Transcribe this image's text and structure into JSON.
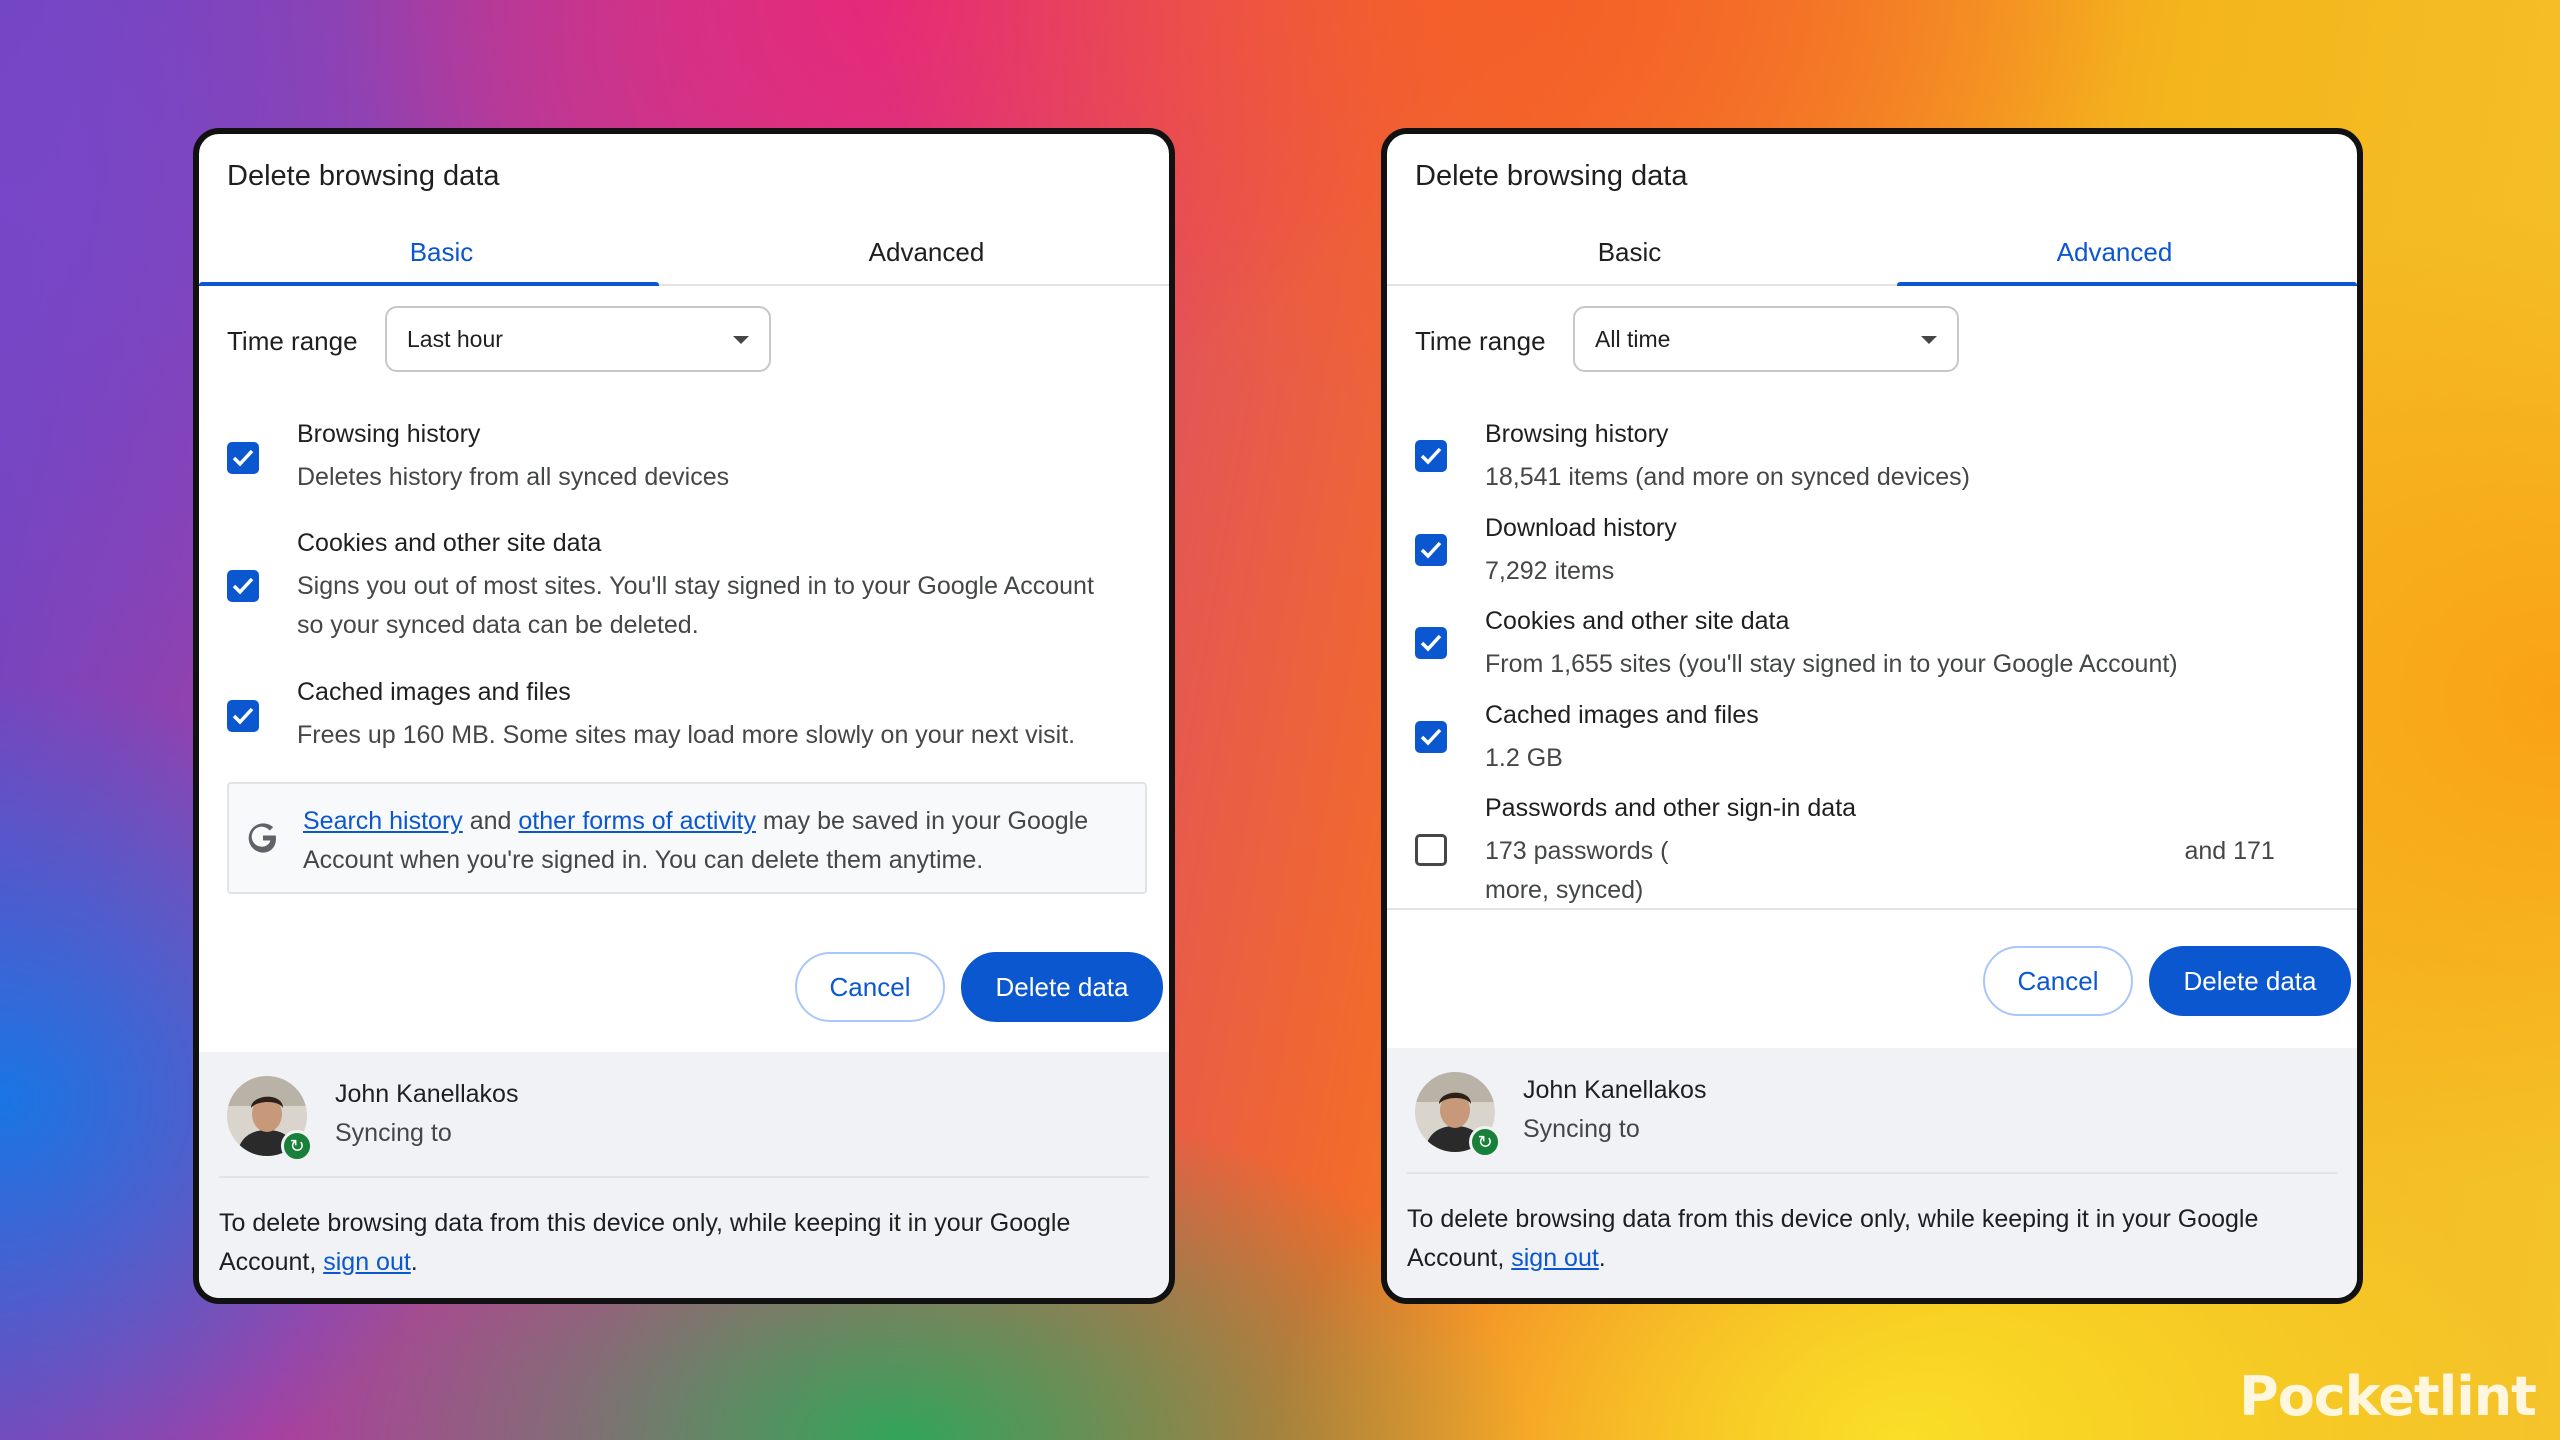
{
  "dialogs": {
    "basic": {
      "title": "Delete browsing data",
      "tabs": {
        "basic": "Basic",
        "advanced": "Advanced"
      },
      "active_tab": "Basic",
      "time_range": {
        "label": "Time range",
        "value": "Last hour"
      },
      "options": [
        {
          "title": "Browsing history",
          "desc": "Deletes history from all synced devices",
          "checked": true
        },
        {
          "title": "Cookies and other site data",
          "desc": "Signs you out of most sites. You'll stay signed in to your Google Account so your synced data can be deleted.",
          "checked": true
        },
        {
          "title": "Cached images and files",
          "desc": "Frees up 160 MB. Some sites may load more slowly on your next visit.",
          "checked": true
        }
      ],
      "info": {
        "link1": "Search history",
        "and": " and ",
        "link2": "other forms of activity",
        "rest": " may be saved in your Google Account when you're signed in. You can delete them anytime."
      },
      "buttons": {
        "cancel": "Cancel",
        "delete": "Delete data"
      },
      "user": {
        "name": "John Kanellakos",
        "status": "Syncing to"
      },
      "footer": {
        "text": "To delete browsing data from this device only, while keeping it in your Google Account, ",
        "link": "sign out",
        "end": "."
      }
    },
    "advanced": {
      "title": "Delete browsing data",
      "tabs": {
        "basic": "Basic",
        "advanced": "Advanced"
      },
      "active_tab": "Advanced",
      "time_range": {
        "label": "Time range",
        "value": "All time"
      },
      "options": [
        {
          "title": "Browsing history",
          "desc": "18,541 items (and more on synced devices)",
          "checked": true
        },
        {
          "title": "Download history",
          "desc": "7,292 items",
          "checked": true
        },
        {
          "title": "Cookies and other site data",
          "desc": "From 1,655 sites (you'll stay signed in to your Google Account)",
          "checked": true
        },
        {
          "title": "Cached images and files",
          "desc": "1.2 GB",
          "checked": true
        },
        {
          "title": "Passwords and other sign-in data",
          "desc_a": "173 passwords (",
          "desc_b": "and 171",
          "desc_c": "more, synced)",
          "checked": false
        }
      ],
      "buttons": {
        "cancel": "Cancel",
        "delete": "Delete data"
      },
      "user": {
        "name": "John Kanellakos",
        "status": "Syncing to"
      },
      "footer": {
        "text": "To delete browsing data from this device only, while keeping it in your Google Account, ",
        "link": "sign out",
        "end": "."
      }
    }
  },
  "watermark": "Pocketlint",
  "colors": {
    "accent": "#0b57d0",
    "sync_badge": "#188038"
  }
}
